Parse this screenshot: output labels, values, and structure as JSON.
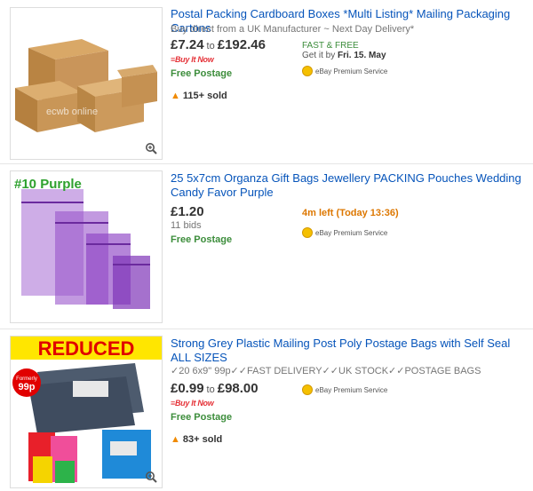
{
  "listings": [
    {
      "title": "Postal Packing Cardboard Boxes *Multi Listing* Mailing Packaging Cartons",
      "subtitle": "Buy direct from a UK Manufacturer ~ Next Day Delivery*",
      "price_from": "£7.24",
      "price_to_word": "to",
      "price_to": "£192.46",
      "buy_it_now": "Buy It Now",
      "postage": "Free Postage",
      "sold": "115+ sold",
      "fast_free": "FAST & FREE",
      "get_it_prefix": "Get it by",
      "get_it_date": "Fri. 15. May",
      "premium": "eBay Premium Service",
      "watermark": "ecwb online"
    },
    {
      "title": "25 5x7cm Organza Gift Bags Jewellery PACKING Pouches Wedding Candy Favor Purple",
      "price": "£1.20",
      "bids": "11 bids",
      "postage": "Free Postage",
      "time_left": "4m left (Today 13:36)",
      "premium": "eBay Premium Service",
      "image_caption": "#10 Purple"
    },
    {
      "title": "Strong Grey Plastic Mailing Post Poly Postage Bags with Self Seal ALL SIZES",
      "subtitle": "✓20 6x9\" 99p✓✓FAST DELIVERY✓✓UK STOCK✓✓POSTAGE BAGS",
      "price_from": "£0.99",
      "price_to_word": "to",
      "price_to": "£98.00",
      "buy_it_now": "Buy It Now",
      "postage": "Free Postage",
      "sold": "83+ sold",
      "premium": "eBay Premium Service",
      "image_banner": "REDUCED",
      "image_badge_line1": "Formerly",
      "image_badge_line2": "99p"
    }
  ],
  "icons": {
    "zoom": "magnifier-icon",
    "hot": "flame-icon",
    "premium": "medal-icon"
  }
}
